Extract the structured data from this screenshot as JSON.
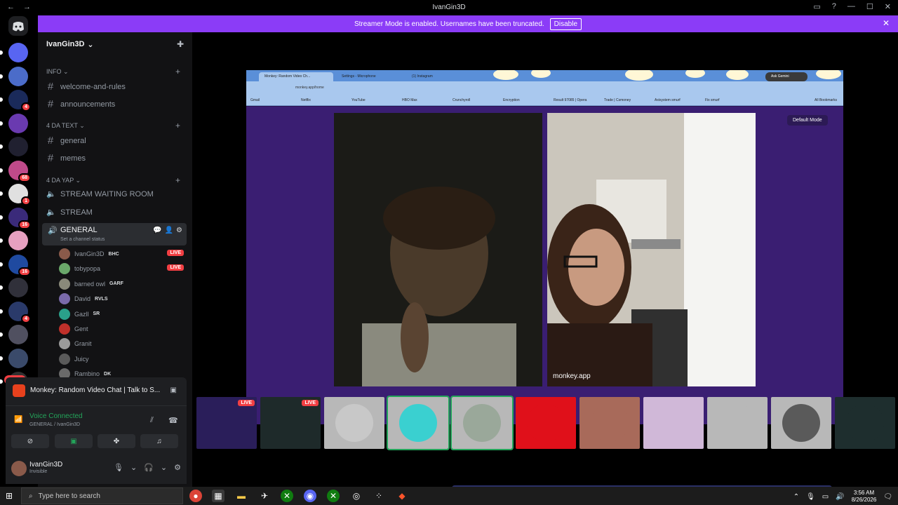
{
  "window": {
    "title": "IvanGin3D",
    "back": "←",
    "forward": "→",
    "controls": [
      "▭",
      "?",
      "—",
      "☐",
      "✕"
    ]
  },
  "banner": {
    "text": "Streamer Mode is enabled. Usernames have been truncated.",
    "button": "Disable",
    "close": "✕"
  },
  "rail": {
    "servers": [
      {
        "color": "#5865f2",
        "badge": ""
      },
      {
        "color": "#4b6cc9",
        "badge": ""
      },
      {
        "color": "#1a2a5a",
        "badge": "4"
      },
      {
        "color": "#6a3ab0",
        "badge": ""
      },
      {
        "color": "#202030",
        "badge": ""
      },
      {
        "color": "#c04a8a",
        "badge": "68"
      },
      {
        "color": "#e0e0e0",
        "badge": "1"
      },
      {
        "color": "#3a2a7a",
        "badge": "16"
      },
      {
        "color": "#e6a0c0",
        "badge": ""
      },
      {
        "color": "#1f4aa0",
        "badge": "16"
      },
      {
        "color": "#30303a",
        "badge": ""
      },
      {
        "color": "#2a3a6a",
        "badge": "4"
      },
      {
        "color": "#505060",
        "badge": ""
      },
      {
        "color": "#3a4a6a",
        "badge": ""
      },
      {
        "color": "#303030",
        "badge": ""
      }
    ],
    "new_label": "NEW"
  },
  "sidebar": {
    "server_name": "IvanGin3D",
    "categories": [
      {
        "name": "INFO",
        "channels": [
          "welcome-and-rules",
          "announcements"
        ]
      },
      {
        "name": "4 DA TEXT",
        "channels": [
          "general",
          "memes"
        ]
      },
      {
        "name": "4 DA YAP",
        "channels": [
          "STREAM WAITING ROOM",
          "STREAM"
        ]
      }
    ],
    "voice_channel": {
      "name": "GENERAL",
      "status": "Set a channel status"
    },
    "members": [
      {
        "name": "IvanGin3D",
        "tag": "BHC",
        "live": "LIVE",
        "color": "#8a5a4a"
      },
      {
        "name": "tobypopa",
        "tag": "",
        "live": "LIVE",
        "color": "#6aa86a"
      },
      {
        "name": "barned owl",
        "tag": "GARF",
        "live": "",
        "color": "#8a8a7a"
      },
      {
        "name": "David",
        "tag": "RVLS",
        "live": "",
        "color": "#7a6aaa"
      },
      {
        "name": "Gazll",
        "tag": "SR",
        "live": "",
        "color": "#2aa08a"
      },
      {
        "name": "Gent",
        "tag": "",
        "live": "",
        "color": "#c0302a"
      },
      {
        "name": "Granit",
        "tag": "",
        "live": "",
        "color": "#9a9a9a"
      },
      {
        "name": "Juicy",
        "tag": "",
        "live": "",
        "color": "#5a5a5a"
      },
      {
        "name": "Rambino",
        "tag": "DK",
        "live": "",
        "color": "#6a6a6a"
      }
    ]
  },
  "activity": {
    "title": "Monkey: Random Video Chat | Talk to S..."
  },
  "voice": {
    "status": "Voice Connected",
    "location": "GENERAL / IvanGin3D"
  },
  "user": {
    "name": "IvanGin3D",
    "status": "Invisible"
  },
  "stream": {
    "tabs": [
      "Monkey: Random Video Ch...",
      "Settings - Microphone",
      "(1) Instagram"
    ],
    "ask": "Ask Gemini",
    "url": "monkey.app/home",
    "bookmarks": [
      "Gmail",
      "Netflix",
      "YouTube",
      "HBO Max",
      "Crunchyroll",
      "Encryption",
      "Result 97085 | Opera",
      "Trade | Csmoney",
      "Axisystem smurf",
      "Fix smurf",
      "All Bookmarks"
    ],
    "default_mode": "Default Mode",
    "watermark": "monkey.app"
  },
  "thumbnails": [
    {
      "live": "LIVE",
      "color": "#2a1e5a"
    },
    {
      "live": "LIVE",
      "color": "#1e2a2a"
    },
    {
      "live": "",
      "color": "#c8c8c8"
    },
    {
      "live": "",
      "color": "#3ad0d0"
    },
    {
      "live": "",
      "color": "#9aa89a"
    },
    {
      "live": "",
      "color": "#e0101a"
    },
    {
      "live": "",
      "color": "#a86a5a"
    },
    {
      "live": "",
      "color": "#d0b8d8"
    },
    {
      "live": "",
      "color": "#b8b8b8"
    },
    {
      "live": "",
      "color": "#5a5a5a"
    },
    {
      "live": "",
      "color": "#1e2e2e"
    }
  ],
  "taskbar": {
    "search_placeholder": "Type here to search",
    "time": "3:56 AM",
    "date": "8/26/2026"
  }
}
